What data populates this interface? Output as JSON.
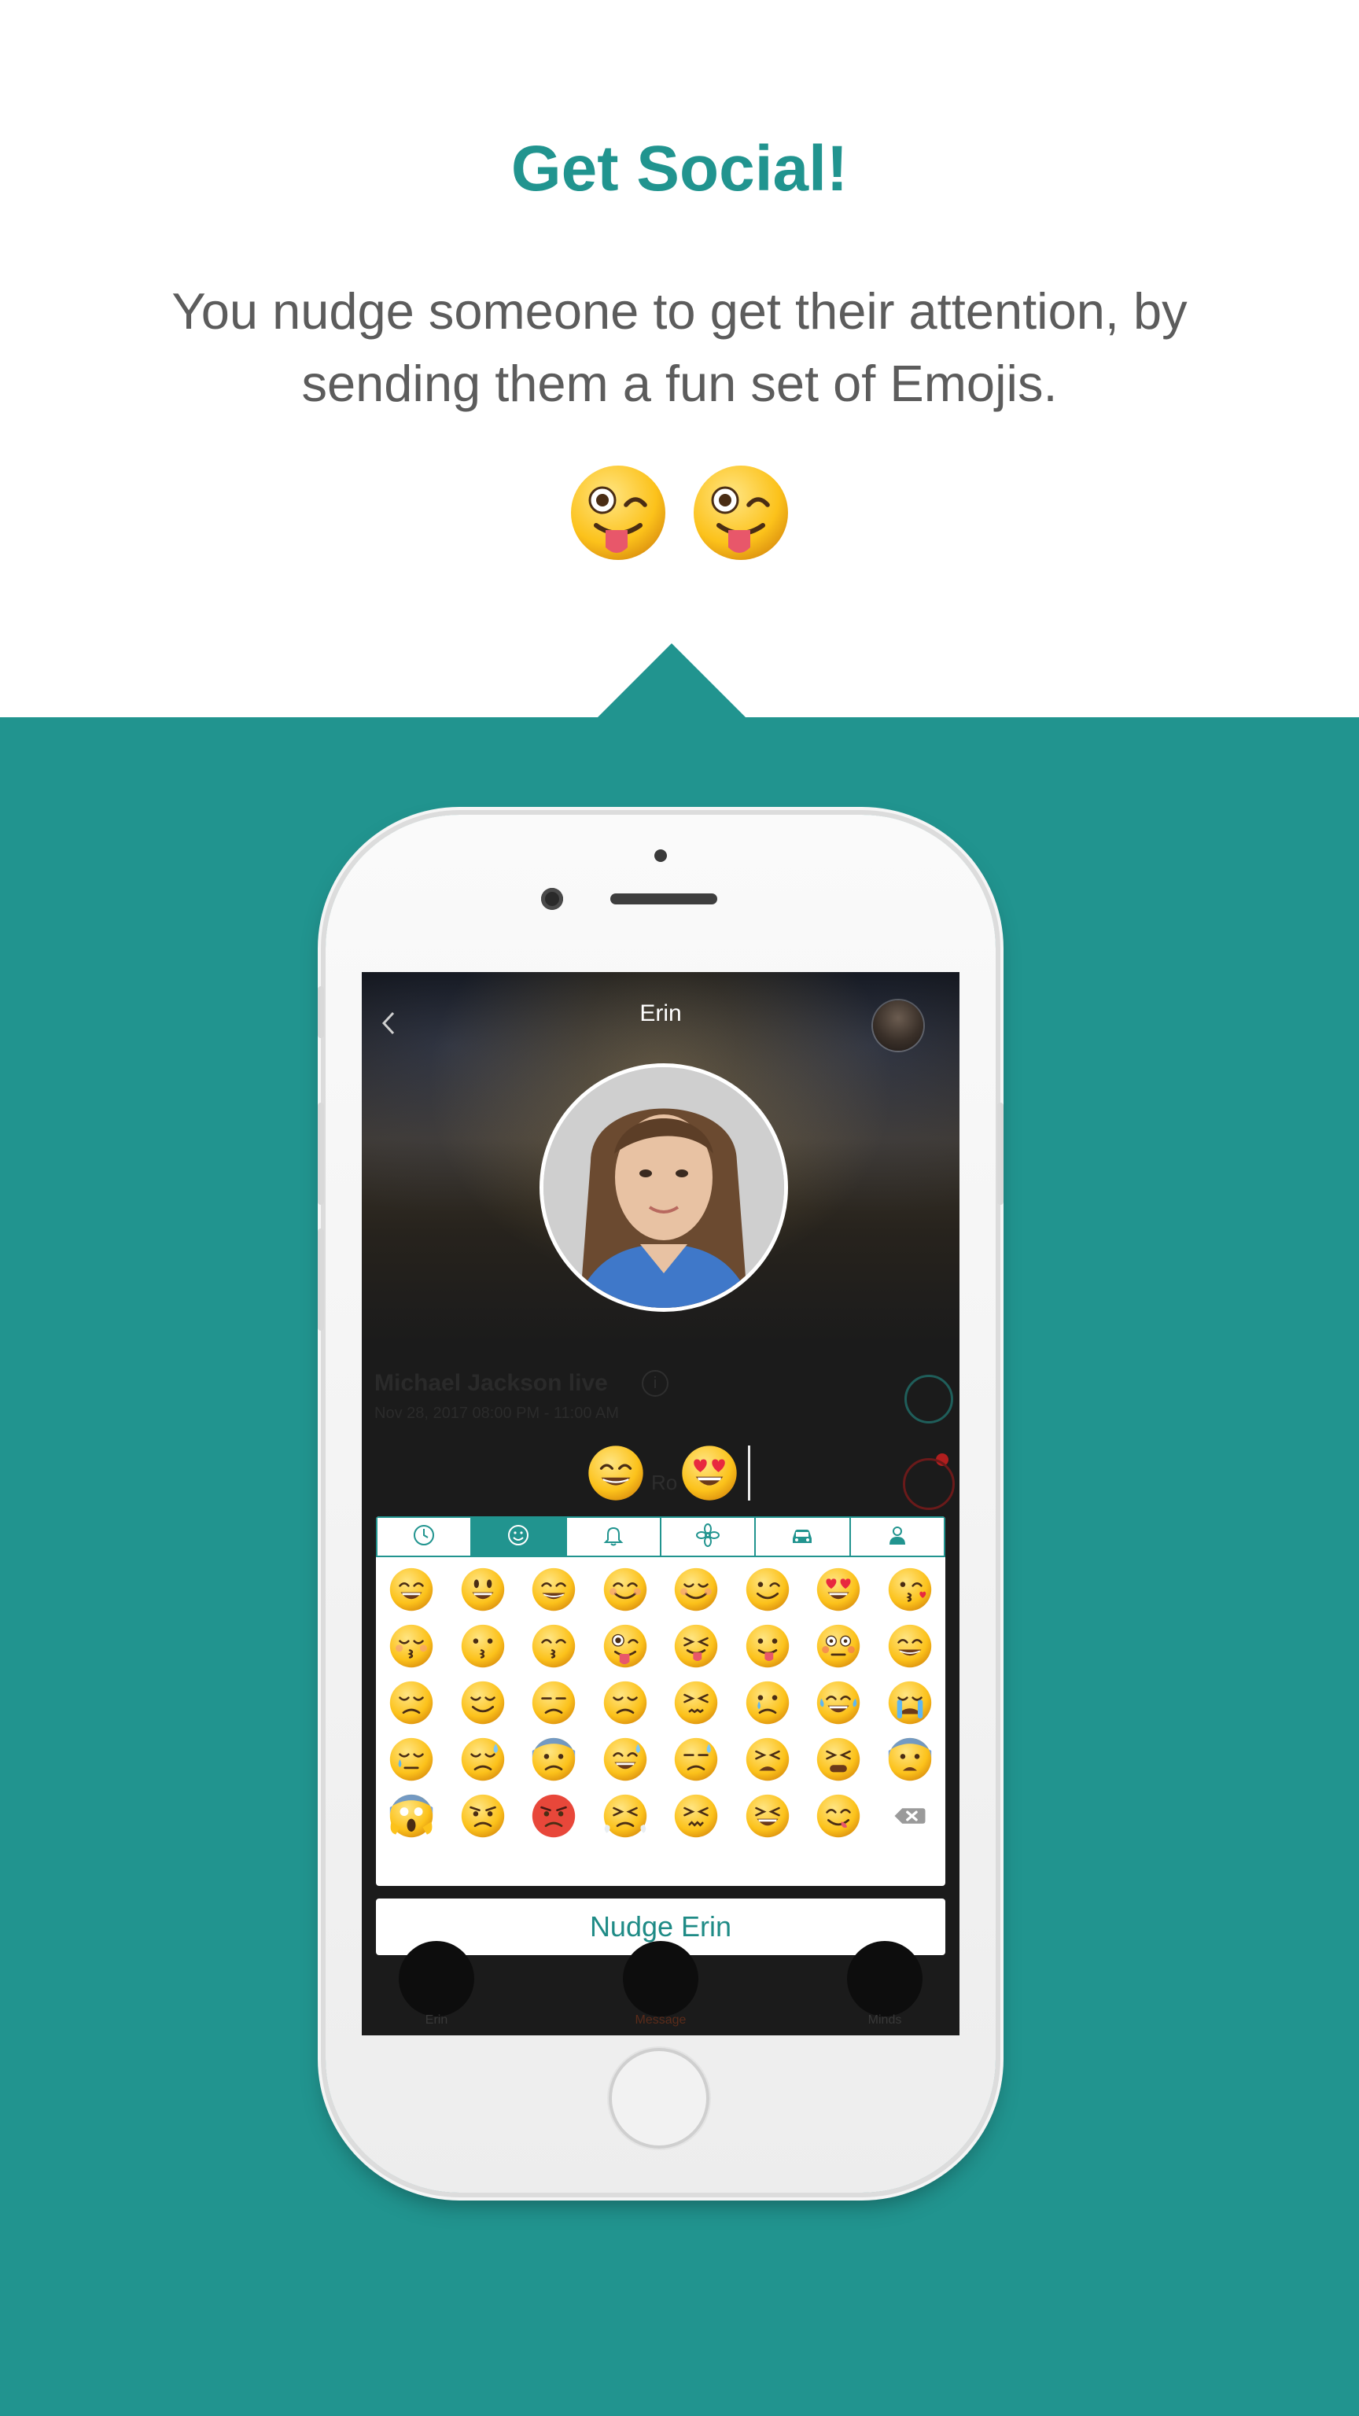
{
  "hero": {
    "title": "Get Social!",
    "subtitle": "You nudge someone to get their attention, by sending them a fun set of Emojis.",
    "emojis": [
      "winking-face-with-tongue",
      "winking-face-with-tongue"
    ]
  },
  "colors": {
    "accent": "#21948f",
    "text_gray": "#5c5c5c",
    "screen_dark": "#1b1b1b"
  },
  "screen": {
    "title": "Erin",
    "event_name": "Michael Jackson live",
    "event_date": "Nov 28, 2017 08:00 PM - 11:00 AM",
    "ghost_label": "Ro",
    "preview_emojis": [
      "grinning-face-with-smiling-eyes",
      "heart-eyes"
    ],
    "keyboard": {
      "tabs": [
        {
          "icon": "clock-icon",
          "active": false
        },
        {
          "icon": "smiley-icon",
          "active": true
        },
        {
          "icon": "bell-icon",
          "active": false
        },
        {
          "icon": "flower-icon",
          "active": false
        },
        {
          "icon": "car-icon",
          "active": false
        },
        {
          "icon": "person-icon",
          "active": false
        }
      ],
      "emojis": [
        "grinning",
        "smiley",
        "grin-teeth",
        "blush",
        "relaxed",
        "wink",
        "heart-eyes",
        "kissing-heart",
        "kissing-closed-eyes",
        "kissing",
        "kissing-smiling-eyes",
        "stuck-out-tongue-winking",
        "squinting-tongue",
        "stuck-out-tongue",
        "flushed",
        "beaming",
        "pensive",
        "relieved",
        "unamused",
        "disappointed",
        "persevere",
        "cry",
        "joy",
        "sob",
        "sleepy",
        "disappointed-relieved",
        "cold-sweat",
        "sweat-smile",
        "sweat",
        "weary",
        "tired",
        "fearful",
        "scream",
        "angry",
        "rage",
        "triumph",
        "confounded",
        "laughing",
        "yum",
        "backspace-icon"
      ]
    },
    "nudge_button": "Nudge Erin",
    "bottom_labels": [
      "Erin",
      "Message",
      "Minds"
    ]
  }
}
